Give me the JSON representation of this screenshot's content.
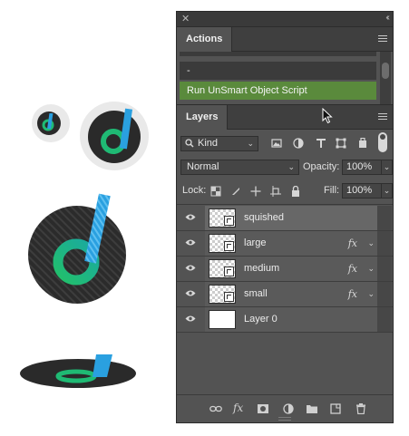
{
  "colors": {
    "panel_bg": "#535353",
    "selected_action": "#5a8a3c",
    "logo_green": "#1fba74",
    "logo_blue": "#2aa0e0",
    "logo_dark": "#2a2a2a"
  },
  "window": {
    "close_icon": "close-icon",
    "collapse_icon": "double-chevron-icon"
  },
  "actions_panel": {
    "tab_label": "Actions",
    "items": [
      {
        "label": "-"
      },
      {
        "label": "Run UnSmart Object Script"
      }
    ]
  },
  "layers_panel": {
    "tab_label": "Layers",
    "filter": {
      "kind_label": "Kind",
      "filter_icons": [
        "image-filter-icon",
        "adjustment-filter-icon",
        "type-filter-icon",
        "shape-filter-icon",
        "smart-object-filter-icon"
      ]
    },
    "blend_mode": "Normal",
    "opacity_label": "Opacity:",
    "opacity_value": "100%",
    "lock_label": "Lock:",
    "fill_label": "Fill:",
    "fill_value": "100%",
    "layers": [
      {
        "name": "squished",
        "visible": true,
        "fx": "",
        "selected": true
      },
      {
        "name": "large",
        "visible": true,
        "fx": "fx",
        "selected": false
      },
      {
        "name": "medium",
        "visible": true,
        "fx": "fx",
        "selected": false
      },
      {
        "name": "small",
        "visible": true,
        "fx": "fx",
        "selected": false
      },
      {
        "name": "Layer 0",
        "visible": true,
        "fx": "",
        "selected": false
      }
    ],
    "bottom_icons": [
      "link-icon",
      "fx-icon",
      "mask-icon",
      "adjustment-icon",
      "folder-icon",
      "new-layer-icon",
      "trash-icon"
    ],
    "fx_label": "fx"
  }
}
